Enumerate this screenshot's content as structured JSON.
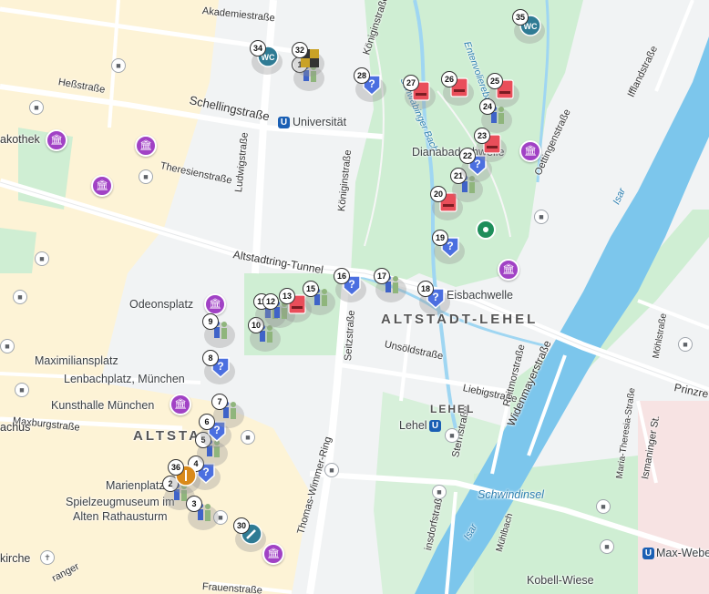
{
  "streets": {
    "akademie": "Akademiestraße",
    "konigin_top": "Königinstraße",
    "hess": "Heßstraße",
    "schelling": "Schellingstraße",
    "theresien": "Theresienstraße",
    "ludwig": "Ludwigstraße",
    "konigin_mid": "Königinstraße",
    "altstadtring": "Altstadtring-Tunnel",
    "oettingen": "Oettingenstraße",
    "ifflandstr": "Ifflandstraße",
    "seitz": "Seitzstraße",
    "unsold": "Unsöldstraße",
    "liebig": "Liebigstraße",
    "reitmor": "Reitmorstraße",
    "widenmayer": "Widenmayerstraße",
    "stern": "Sternstraße",
    "maxburg": "Maxburgstraße",
    "thomas": "Thomas-Wimmer-Ring",
    "mariath": "Maria-Theresia-Straße",
    "ismaninger": "Ismaninger St.",
    "mohl": "Möhlstraße",
    "frauen": "Frauenstraße",
    "prinz": "Prinzre",
    "schwabing_bach": "Schwabinger Bach",
    "eisbach": "Entenvolierebach",
    "isar": "Isar",
    "akothek": "akothek",
    "achus": "achus",
    "kirche": "kirche",
    "ranger": "ranger",
    "ischa": "ischa",
    "dorf": "insdorfstraße",
    "muhl": "Mühlbach",
    "isar2": "Isar"
  },
  "places": {
    "universitat": "Universität",
    "dianabad": "Dianabadschwelle",
    "eisbachwelle": "Eisbachwelle",
    "odeonsplatz": "Odeonsplatz",
    "maximiliansplatz": "Maximiliansplatz",
    "lenbach": "Lenbachplatz, München",
    "kunsthalle": "Kunsthalle München",
    "marienplatz": "Marienplatz",
    "spielzeug1": "Spielzeugmuseum im",
    "spielzeug2": "Alten Rathausturm",
    "lehel_station": "Lehel",
    "schwindinsel": "Schwindinsel",
    "maxweber": "Max-Weber",
    "kobell": "Kobell-Wiese"
  },
  "districts": {
    "altstadt_lehel": "ALTSTADT-LEHEL",
    "altstadt": "ALTSTA",
    "lehel": "LEHEL"
  },
  "markers": [
    {
      "n": "1",
      "type": "people"
    },
    {
      "n": "2",
      "type": "people"
    },
    {
      "n": "3",
      "type": "people"
    },
    {
      "n": "4",
      "type": "info"
    },
    {
      "n": "5",
      "type": "people"
    },
    {
      "n": "6",
      "type": "info"
    },
    {
      "n": "7",
      "type": "people"
    },
    {
      "n": "8",
      "type": "info"
    },
    {
      "n": "9",
      "type": "people"
    },
    {
      "n": "10",
      "type": "people"
    },
    {
      "n": "11",
      "type": "people"
    },
    {
      "n": "12",
      "type": "people"
    },
    {
      "n": "13",
      "type": "bench"
    },
    {
      "n": "15",
      "type": "people"
    },
    {
      "n": "16",
      "type": "info"
    },
    {
      "n": "17",
      "type": "people"
    },
    {
      "n": "18",
      "type": "info"
    },
    {
      "n": "19",
      "type": "info"
    },
    {
      "n": "20",
      "type": "bench"
    },
    {
      "n": "21",
      "type": "people"
    },
    {
      "n": "22",
      "type": "info"
    },
    {
      "n": "23",
      "type": "bench"
    },
    {
      "n": "24",
      "type": "people"
    },
    {
      "n": "25",
      "type": "bench"
    },
    {
      "n": "26",
      "type": "bench"
    },
    {
      "n": "27",
      "type": "bench"
    },
    {
      "n": "28",
      "type": "info"
    },
    {
      "n": "30",
      "type": "tool"
    },
    {
      "n": "32",
      "type": "flag"
    },
    {
      "n": "34",
      "type": "wc"
    },
    {
      "n": "35",
      "type": "wc"
    },
    {
      "n": "36",
      "type": "bell"
    }
  ],
  "icons": {
    "ubahn": "U",
    "museum": "museum-icon",
    "transit": "bus-icon",
    "pin": "location-pin-icon"
  },
  "colors": {
    "park": "#cfeed3",
    "water": "#9fd6f2",
    "river": "#7cc6ec",
    "road": "#ffffff",
    "pedestrian": "#fdf3d6",
    "poi": "#a142c5",
    "ubahn": "#1a5fb4",
    "info": "#4b6fe0",
    "bench": "#e94e5a"
  }
}
